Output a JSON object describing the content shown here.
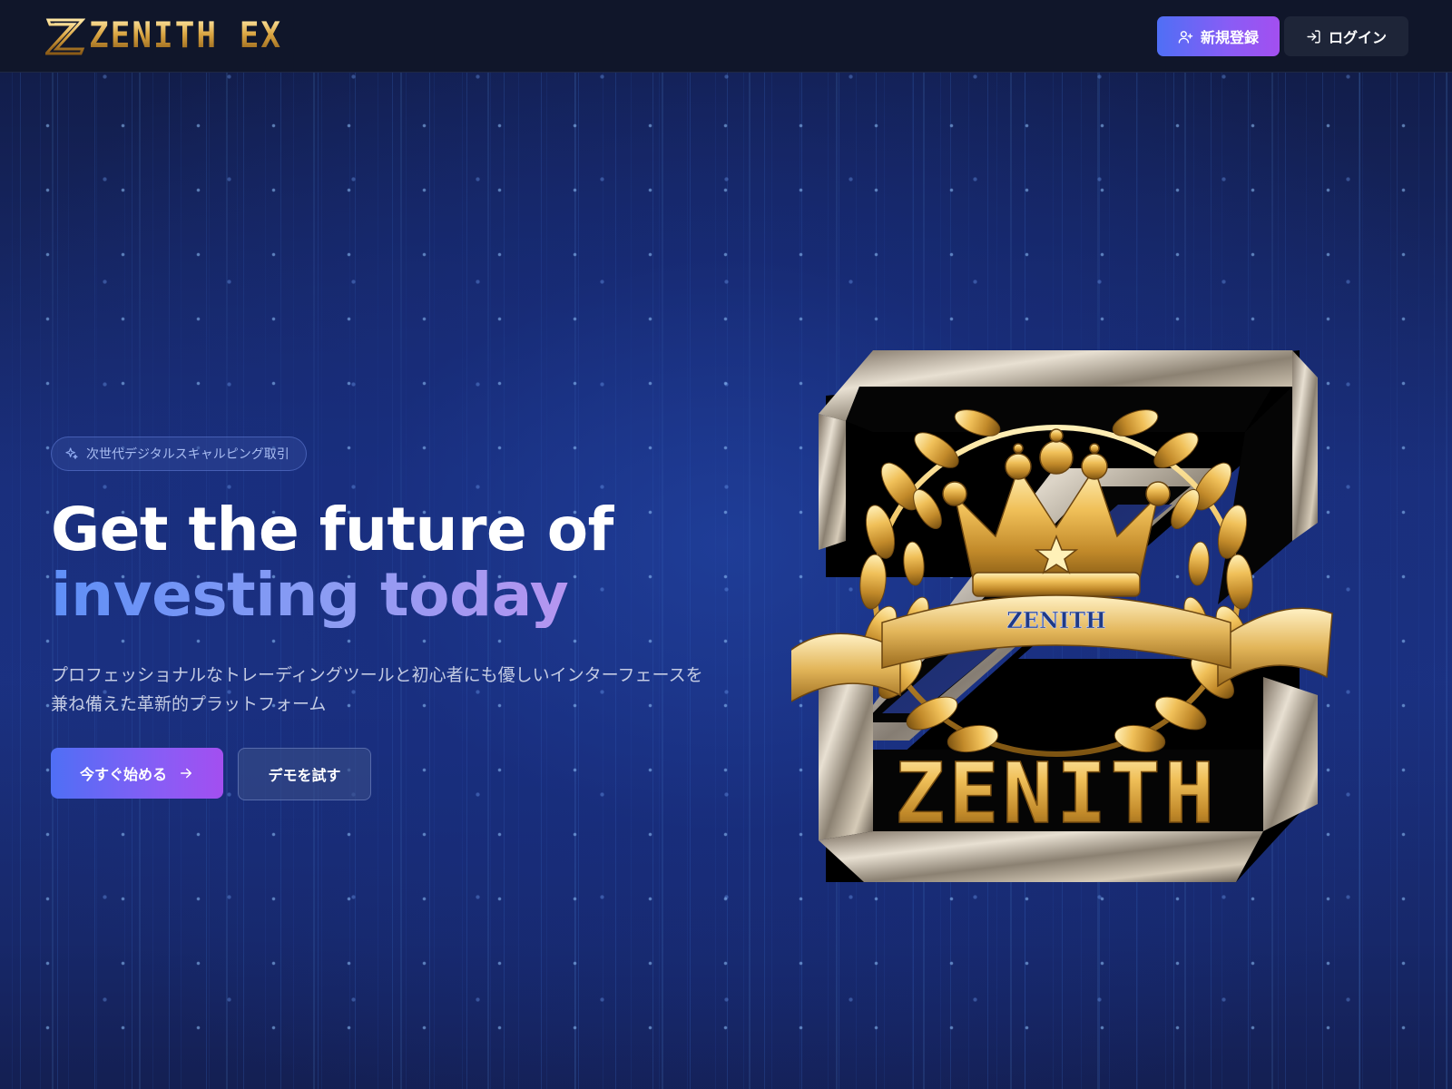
{
  "header": {
    "logo_text": "ZENITH EX",
    "register_label": "新規登録",
    "login_label": "ログイン"
  },
  "hero": {
    "badge_label": "次世代デジタルスキャルピング取引",
    "headline_line1": "Get the future of",
    "headline_line2": "investing today",
    "subtext": "プロフェッショナルなトレーディングツールと初心者にも優しいインターフェースを兼ね備えた革新的プラットフォーム",
    "start_label": "今すぐ始める",
    "demo_label": "デモを試す"
  },
  "emblem": {
    "ribbon_text": "ZENITH",
    "wordmark": "ZENITH"
  },
  "colors": {
    "accent_start": "#4f6ff5",
    "accent_end": "#a34ff0",
    "gold": "#d9a441",
    "header_bg": "#10162a"
  },
  "icons": {
    "register": "user-plus-icon",
    "login": "login-icon",
    "badge": "sparkles-icon",
    "start": "arrow-right-icon"
  }
}
